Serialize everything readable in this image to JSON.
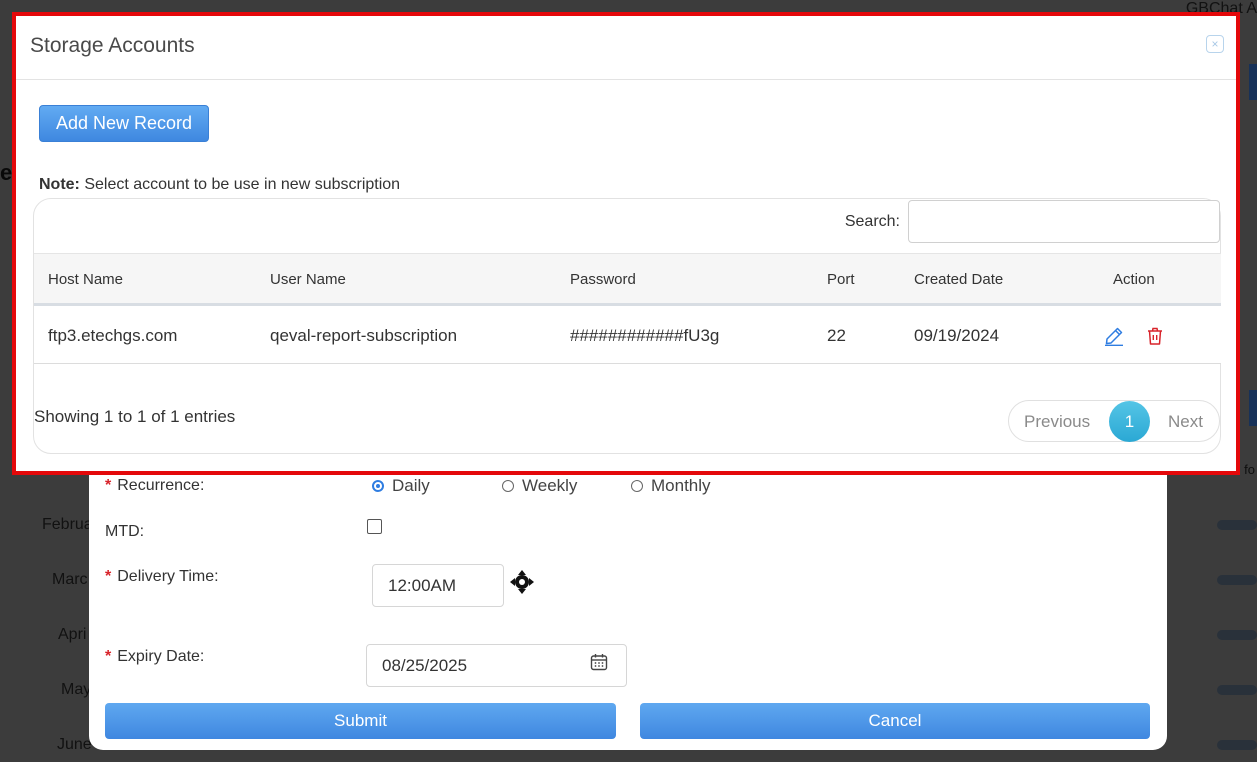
{
  "background": {
    "top_right_text": "GBChat A",
    "left_letter": "e",
    "right_text": "fo",
    "months": [
      "Februa",
      "Marc",
      "Apri",
      "May",
      "June"
    ]
  },
  "subscription_form": {
    "recurrence_label": "Recurrence:",
    "recurrence_options": [
      "Daily",
      "Weekly",
      "Monthly"
    ],
    "recurrence_selected": "Daily",
    "mtd_label": "MTD:",
    "delivery_time_label": "Delivery Time:",
    "delivery_time_value": "12:00AM",
    "expiry_date_label": "Expiry Date:",
    "expiry_date_value": "08/25/2025",
    "submit_label": "Submit",
    "cancel_label": "Cancel",
    "required_marker": "*"
  },
  "storage_modal": {
    "title": "Storage Accounts",
    "close_glyph": "×",
    "add_button_label": "Add New Record",
    "note_bold": "Note:",
    "note_text": " Select account to be use in new subscription",
    "search_label": "Search:",
    "search_value": "",
    "columns": [
      "Host Name",
      "User Name",
      "Password",
      "Port",
      "Created Date",
      "Action"
    ],
    "rows": [
      {
        "host": "ftp3.etechgs.com",
        "user": "qeval-report-subscription",
        "password": "############fU3g",
        "port": "22",
        "created": "09/19/2024"
      }
    ],
    "showing_text": "Showing 1 to 1 of 1 entries",
    "pagination": {
      "previous": "Previous",
      "current": "1",
      "next": "Next"
    }
  },
  "colors": {
    "highlight": "#e4080a",
    "primary_button": "#3f88e0",
    "page_active": "#2aa8d4",
    "edit_icon": "#2f7de1",
    "delete_icon": "#d8232a"
  },
  "icons": {
    "close": "close-icon",
    "edit": "pencil-icon",
    "delete": "trash-icon",
    "time": "move-icon",
    "date": "calendar-icon"
  }
}
